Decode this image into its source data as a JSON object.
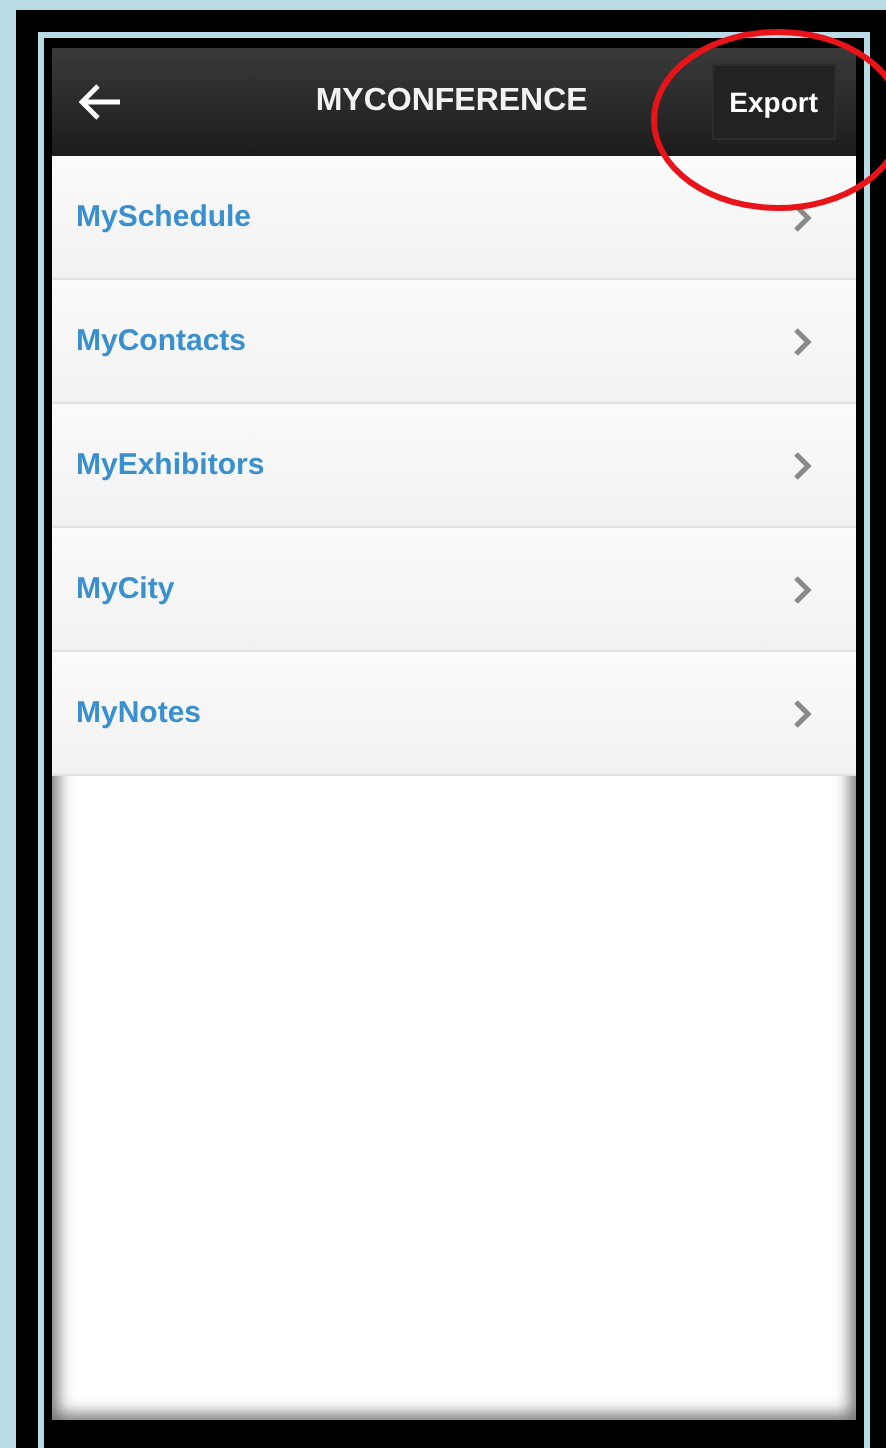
{
  "header": {
    "title": "MYCONFERENCE",
    "action": "Export"
  },
  "items": [
    {
      "label": "MySchedule"
    },
    {
      "label": "MyContacts"
    },
    {
      "label": "MyExhibitors"
    },
    {
      "label": "MyCity"
    },
    {
      "label": "MyNotes"
    }
  ]
}
